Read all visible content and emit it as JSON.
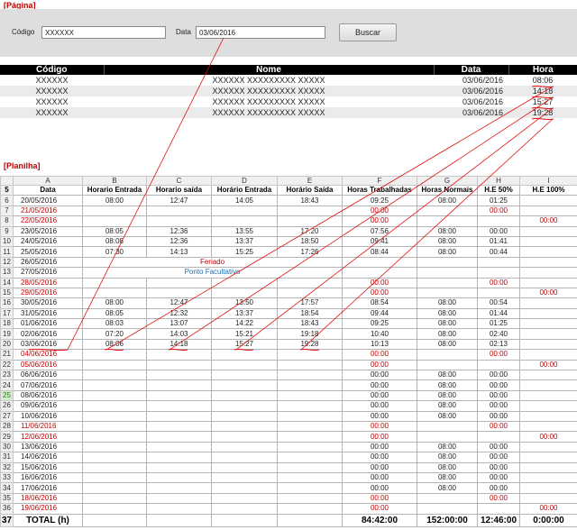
{
  "page_label": "[Página]",
  "sheet_label": "[Planilha]",
  "form": {
    "codigo_label": "Código",
    "codigo_value": "XXXXXX",
    "data_label": "Data",
    "data_value": "03/06/2016",
    "search_label": "Buscar"
  },
  "results": {
    "headers": [
      "Código",
      "Nome",
      "Data",
      "Hora"
    ],
    "rows": [
      [
        "XXXXXX",
        "XXXXXX XXXXXXXXX XXXXX",
        "03/06/2016",
        "08:06"
      ],
      [
        "XXXXXX",
        "XXXXXX XXXXXXXXX XXXXX",
        "03/06/2016",
        "14:18"
      ],
      [
        "XXXXXX",
        "XXXXXX XXXXXXXXX XXXXX",
        "03/06/2016",
        "15:27"
      ],
      [
        "XXXXXX",
        "XXXXXX XXXXXXXXX XXXXX",
        "03/06/2016",
        "19:28"
      ]
    ]
  },
  "sheet": {
    "col_letters": [
      "A",
      "B",
      "C",
      "D",
      "E",
      "F",
      "G",
      "H",
      "I"
    ],
    "headers": [
      "Data",
      "Horario Entrada",
      "Horario saída",
      "Horário Entrada",
      "Horário Saída",
      "Horas Trabalhadas",
      "Horas Normais",
      "H.E 50%",
      "H.E 100%"
    ],
    "header_row_num": "5",
    "rows": [
      {
        "n": "6",
        "v": [
          "20/05/2016",
          "08:00",
          "12:47",
          "14:05",
          "18:43",
          "09:25",
          "08:00",
          "01:25",
          ""
        ]
      },
      {
        "n": "7",
        "w": true,
        "v": [
          "21/05/2016",
          "",
          "",
          "",
          "",
          "00:00",
          "",
          "00:00",
          ""
        ]
      },
      {
        "n": "8",
        "w": true,
        "v": [
          "22/05/2016",
          "",
          "",
          "",
          "",
          "00:00",
          "",
          "",
          "00:00"
        ]
      },
      {
        "n": "9",
        "v": [
          "23/05/2016",
          "08:05",
          "12:36",
          "13:55",
          "17:20",
          "07:56",
          "08:00",
          "00:00",
          ""
        ]
      },
      {
        "n": "10",
        "v": [
          "24/05/2016",
          "08:08",
          "12:36",
          "13:37",
          "18:50",
          "09:41",
          "08:00",
          "01:41",
          ""
        ]
      },
      {
        "n": "11",
        "v": [
          "25/05/2016",
          "07:30",
          "14:13",
          "15:25",
          "17:26",
          "08:44",
          "08:00",
          "00:44",
          ""
        ]
      },
      {
        "n": "12",
        "note": "Feriado",
        "nc": "red",
        "v": [
          "26/05/2016",
          "",
          "",
          "",
          "",
          "",
          "",
          "",
          ""
        ]
      },
      {
        "n": "13",
        "note": "Ponto Facultativo",
        "nc": "blue",
        "v": [
          "27/05/2016",
          "",
          "",
          "",
          "",
          "",
          "",
          "",
          ""
        ]
      },
      {
        "n": "14",
        "w": true,
        "v": [
          "28/05/2016",
          "",
          "",
          "",
          "",
          "00:00",
          "",
          "00:00",
          ""
        ]
      },
      {
        "n": "15",
        "w": true,
        "v": [
          "29/05/2016",
          "",
          "",
          "",
          "",
          "00:00",
          "",
          "",
          "00:00"
        ]
      },
      {
        "n": "16",
        "v": [
          "30/05/2016",
          "08:00",
          "12:47",
          "13:50",
          "17:57",
          "08:54",
          "08:00",
          "00:54",
          ""
        ]
      },
      {
        "n": "17",
        "v": [
          "31/05/2016",
          "08:05",
          "12:32",
          "13:37",
          "18:54",
          "09:44",
          "08:00",
          "01:44",
          ""
        ]
      },
      {
        "n": "18",
        "v": [
          "01/06/2016",
          "08:03",
          "13:07",
          "14:22",
          "18:43",
          "09:25",
          "08:00",
          "01:25",
          ""
        ]
      },
      {
        "n": "19",
        "v": [
          "02/06/2016",
          "07:20",
          "14:03",
          "15:21",
          "19:18",
          "10:40",
          "08:00",
          "02:40",
          ""
        ]
      },
      {
        "n": "20",
        "v": [
          "03/06/2016",
          "08:06",
          "14:18",
          "15:27",
          "19:28",
          "10:13",
          "08:00",
          "02:13",
          ""
        ]
      },
      {
        "n": "21",
        "w": true,
        "v": [
          "04/06/2016",
          "",
          "",
          "",
          "",
          "00:00",
          "",
          "00:00",
          ""
        ]
      },
      {
        "n": "22",
        "w": true,
        "v": [
          "05/06/2016",
          "",
          "",
          "",
          "",
          "00:00",
          "",
          "",
          "00:00"
        ]
      },
      {
        "n": "23",
        "v": [
          "06/06/2016",
          "",
          "",
          "",
          "",
          "00:00",
          "08:00",
          "00:00",
          ""
        ]
      },
      {
        "n": "24",
        "v": [
          "07/06/2016",
          "",
          "",
          "",
          "",
          "00:00",
          "08:00",
          "00:00",
          ""
        ]
      },
      {
        "n": "25",
        "sel": true,
        "v": [
          "08/06/2016",
          "",
          "",
          "",
          "",
          "00:00",
          "08:00",
          "00:00",
          ""
        ]
      },
      {
        "n": "26",
        "v": [
          "09/06/2016",
          "",
          "",
          "",
          "",
          "00:00",
          "08:00",
          "00:00",
          ""
        ]
      },
      {
        "n": "27",
        "v": [
          "10/06/2016",
          "",
          "",
          "",
          "",
          "00:00",
          "08:00",
          "00:00",
          ""
        ]
      },
      {
        "n": "28",
        "w": true,
        "v": [
          "11/06/2016",
          "",
          "",
          "",
          "",
          "00:00",
          "",
          "00:00",
          ""
        ]
      },
      {
        "n": "29",
        "w": true,
        "v": [
          "12/06/2016",
          "",
          "",
          "",
          "",
          "00:00",
          "",
          "",
          "00:00"
        ]
      },
      {
        "n": "30",
        "v": [
          "13/06/2016",
          "",
          "",
          "",
          "",
          "00:00",
          "08:00",
          "00:00",
          ""
        ]
      },
      {
        "n": "31",
        "v": [
          "14/06/2016",
          "",
          "",
          "",
          "",
          "00:00",
          "08:00",
          "00:00",
          ""
        ]
      },
      {
        "n": "32",
        "v": [
          "15/06/2016",
          "",
          "",
          "",
          "",
          "00:00",
          "08:00",
          "00:00",
          ""
        ]
      },
      {
        "n": "33",
        "v": [
          "16/06/2016",
          "",
          "",
          "",
          "",
          "00:00",
          "08:00",
          "00:00",
          ""
        ]
      },
      {
        "n": "34",
        "v": [
          "17/06/2016",
          "",
          "",
          "",
          "",
          "00:00",
          "08:00",
          "00:00",
          ""
        ]
      },
      {
        "n": "35",
        "w": true,
        "v": [
          "18/06/2016",
          "",
          "",
          "",
          "",
          "00:00",
          "",
          "00:00",
          ""
        ]
      },
      {
        "n": "36",
        "w": true,
        "v": [
          "19/06/2016",
          "",
          "",
          "",
          "",
          "00:00",
          "",
          "",
          "00:00"
        ]
      }
    ],
    "total": {
      "n": "37",
      "label": "TOTAL (h)",
      "v": [
        "",
        "",
        "",
        "",
        "84:42:00",
        "152:00:00",
        "12:46:00",
        "0:00:00"
      ]
    }
  },
  "colors": {
    "accent_red": "#c00000",
    "note_blue": "#2070b0",
    "panel": "#dedede",
    "header_black": "#000000"
  }
}
